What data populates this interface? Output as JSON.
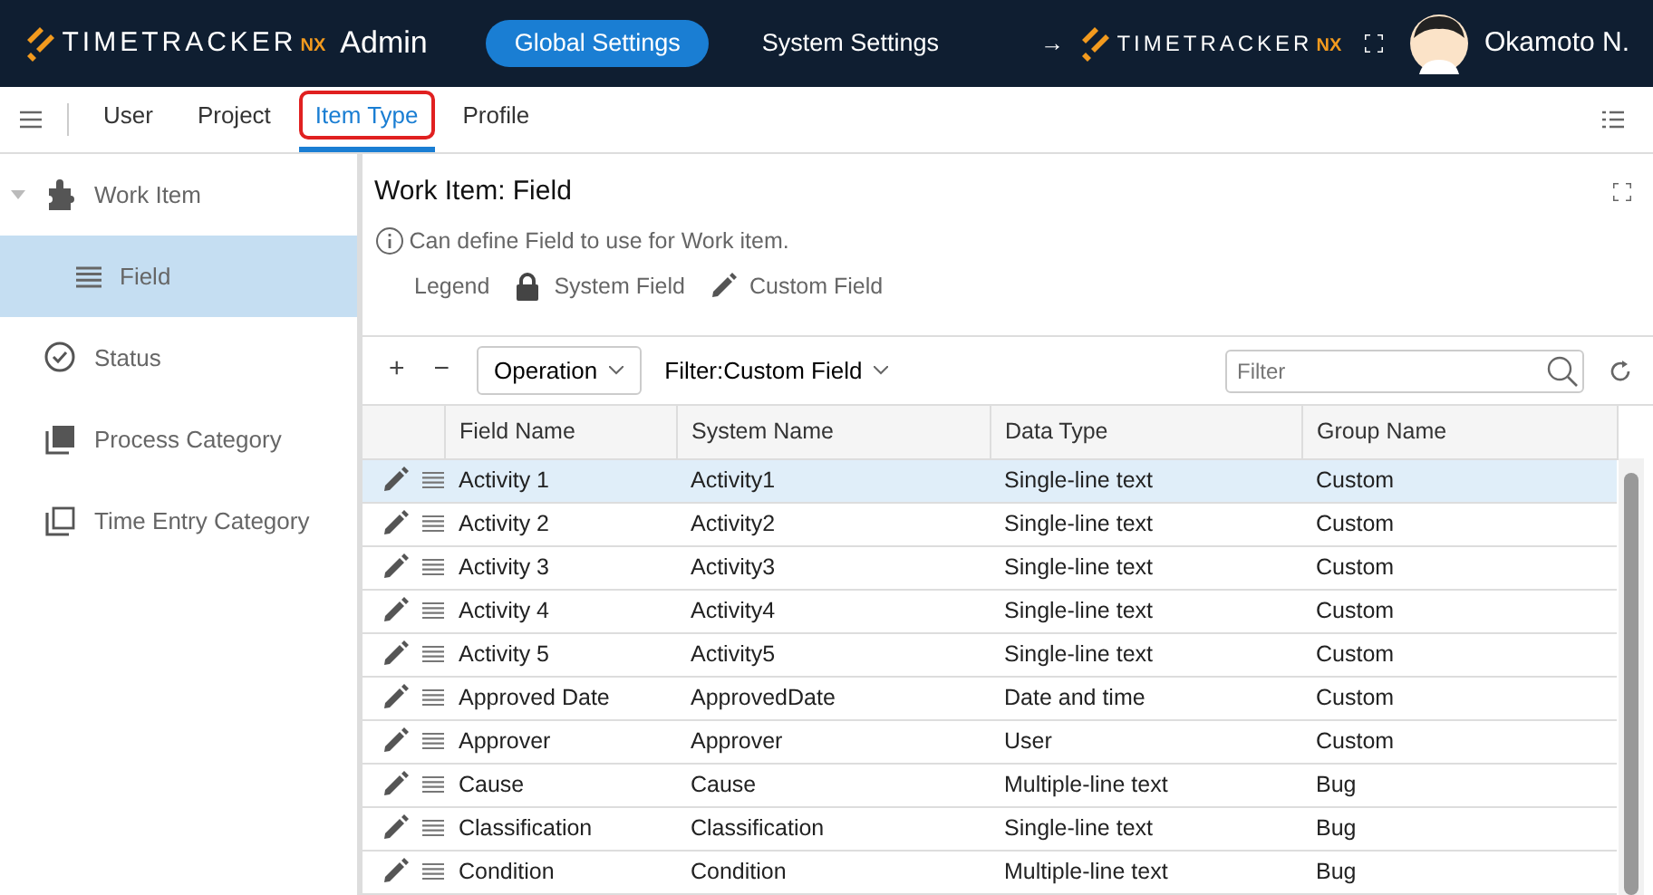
{
  "header": {
    "brand": {
      "name": "TIMETRACKER",
      "suffix": "NX",
      "app": "Admin"
    },
    "nav": [
      {
        "label": "Global Settings",
        "selected": true
      },
      {
        "label": "System Settings",
        "selected": false
      }
    ],
    "link_arrow": "→",
    "link_brand": {
      "name": "TIMETRACKER",
      "suffix": "NX"
    },
    "user": "Okamoto N."
  },
  "tabs": [
    {
      "label": "User",
      "selected": false
    },
    {
      "label": "Project",
      "selected": false
    },
    {
      "label": "Item Type",
      "selected": true
    },
    {
      "label": "Profile",
      "selected": false
    }
  ],
  "sidebar": {
    "items": [
      {
        "label": "Work Item",
        "expanded": true,
        "selected": false,
        "children": [
          {
            "label": "Field",
            "selected": true
          }
        ]
      },
      {
        "label": "Status",
        "selected": false
      },
      {
        "label": "Process Category",
        "selected": false
      },
      {
        "label": "Time Entry Category",
        "selected": false
      }
    ]
  },
  "panel": {
    "title": "Work Item: Field",
    "info": "Can define Field to use for Work item.",
    "legend": {
      "label": "Legend",
      "items": [
        {
          "kind": "system",
          "label": "System Field"
        },
        {
          "kind": "custom",
          "label": "Custom Field"
        }
      ]
    }
  },
  "toolbar": {
    "add": "+",
    "remove": "−",
    "operation": "Operation",
    "filter": "Filter:Custom Field",
    "search": {
      "placeholder": "Filter"
    }
  },
  "table": {
    "columns": [
      "Field Name",
      "System Name",
      "Data Type",
      "Group Name"
    ],
    "rows": [
      {
        "kind": "custom",
        "selected": true,
        "cells": [
          "Activity 1",
          "Activity1",
          "Single-line text",
          "Custom"
        ]
      },
      {
        "kind": "custom",
        "selected": false,
        "cells": [
          "Activity 2",
          "Activity2",
          "Single-line text",
          "Custom"
        ]
      },
      {
        "kind": "custom",
        "selected": false,
        "cells": [
          "Activity 3",
          "Activity3",
          "Single-line text",
          "Custom"
        ]
      },
      {
        "kind": "custom",
        "selected": false,
        "cells": [
          "Activity 4",
          "Activity4",
          "Single-line text",
          "Custom"
        ]
      },
      {
        "kind": "custom",
        "selected": false,
        "cells": [
          "Activity 5",
          "Activity5",
          "Single-line text",
          "Custom"
        ]
      },
      {
        "kind": "custom",
        "selected": false,
        "cells": [
          "Approved Date",
          "ApprovedDate",
          "Date and time",
          "Custom"
        ]
      },
      {
        "kind": "custom",
        "selected": false,
        "cells": [
          "Approver",
          "Approver",
          "User",
          "Custom"
        ]
      },
      {
        "kind": "custom",
        "selected": false,
        "cells": [
          "Cause",
          "Cause",
          "Multiple-line text",
          "Bug"
        ]
      },
      {
        "kind": "custom",
        "selected": false,
        "cells": [
          "Classification",
          "Classification",
          "Single-line text",
          "Bug"
        ]
      },
      {
        "kind": "custom",
        "selected": false,
        "cells": [
          "Condition",
          "Condition",
          "Multiple-line text",
          "Bug"
        ]
      }
    ]
  }
}
